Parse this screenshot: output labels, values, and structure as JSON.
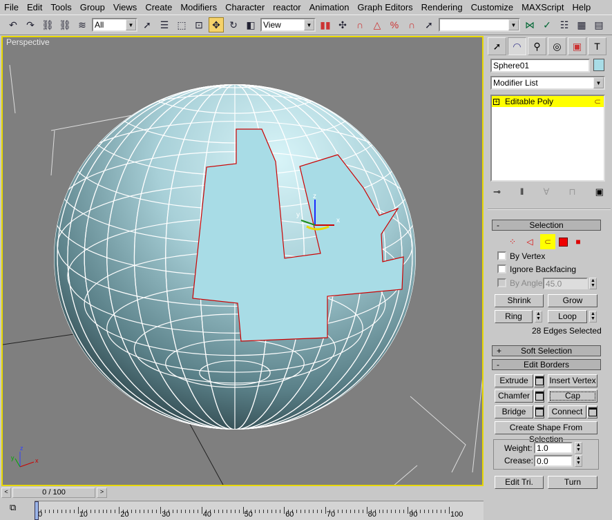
{
  "menu": [
    "File",
    "Edit",
    "Tools",
    "Group",
    "Views",
    "Create",
    "Modifiers",
    "Character",
    "reactor",
    "Animation",
    "Graph Editors",
    "Rendering",
    "Customize",
    "MAXScript",
    "Help"
  ],
  "toolbar": {
    "selection_filter": "All",
    "reference_coord": "View",
    "named_selection": ""
  },
  "viewport": {
    "label": "Perspective",
    "background": "#7f7f7f",
    "border_color": "#e8d800",
    "object_color": "#a8dce6",
    "selection_color": "#cc0000",
    "gizmo_labels": [
      "x",
      "y",
      "z"
    ]
  },
  "panel": {
    "object_name": "Sphere01",
    "object_color": "#a8dce6",
    "modifier_list": "Modifier List",
    "stack": [
      {
        "label": "Editable Poly",
        "selected": true
      }
    ],
    "selection": {
      "title": "Selection",
      "collapse": "-",
      "subobject_modes": [
        "vertex",
        "edge",
        "border",
        "polygon",
        "element"
      ],
      "active_mode": "border",
      "by_vertex": "By Vertex",
      "ignore_backfacing": "Ignore Backfacing",
      "by_angle": "By Angle:",
      "angle_value": "45.0",
      "shrink": "Shrink",
      "grow": "Grow",
      "ring": "Ring",
      "loop": "Loop",
      "status": "28 Edges Selected"
    },
    "soft_selection": {
      "title": "Soft Selection",
      "expand": "+"
    },
    "edit_borders": {
      "title": "Edit Borders",
      "collapse": "-",
      "extrude": "Extrude",
      "insert_vertex": "Insert Vertex",
      "chamfer": "Chamfer",
      "cap": "Cap",
      "bridge": "Bridge",
      "connect": "Connect",
      "create_shape": "Create Shape From Selection",
      "weight_label": "Weight:",
      "weight": "1.0",
      "crease_label": "Crease:",
      "crease": "0.0",
      "edit_tri": "Edit Tri.",
      "turn": "Turn"
    }
  },
  "timeline": {
    "slider": "0 / 100",
    "prev": "<",
    "next": ">",
    "ticks": [
      "0",
      "10",
      "20",
      "30",
      "40",
      "50",
      "60",
      "70",
      "80",
      "90",
      "100"
    ]
  }
}
